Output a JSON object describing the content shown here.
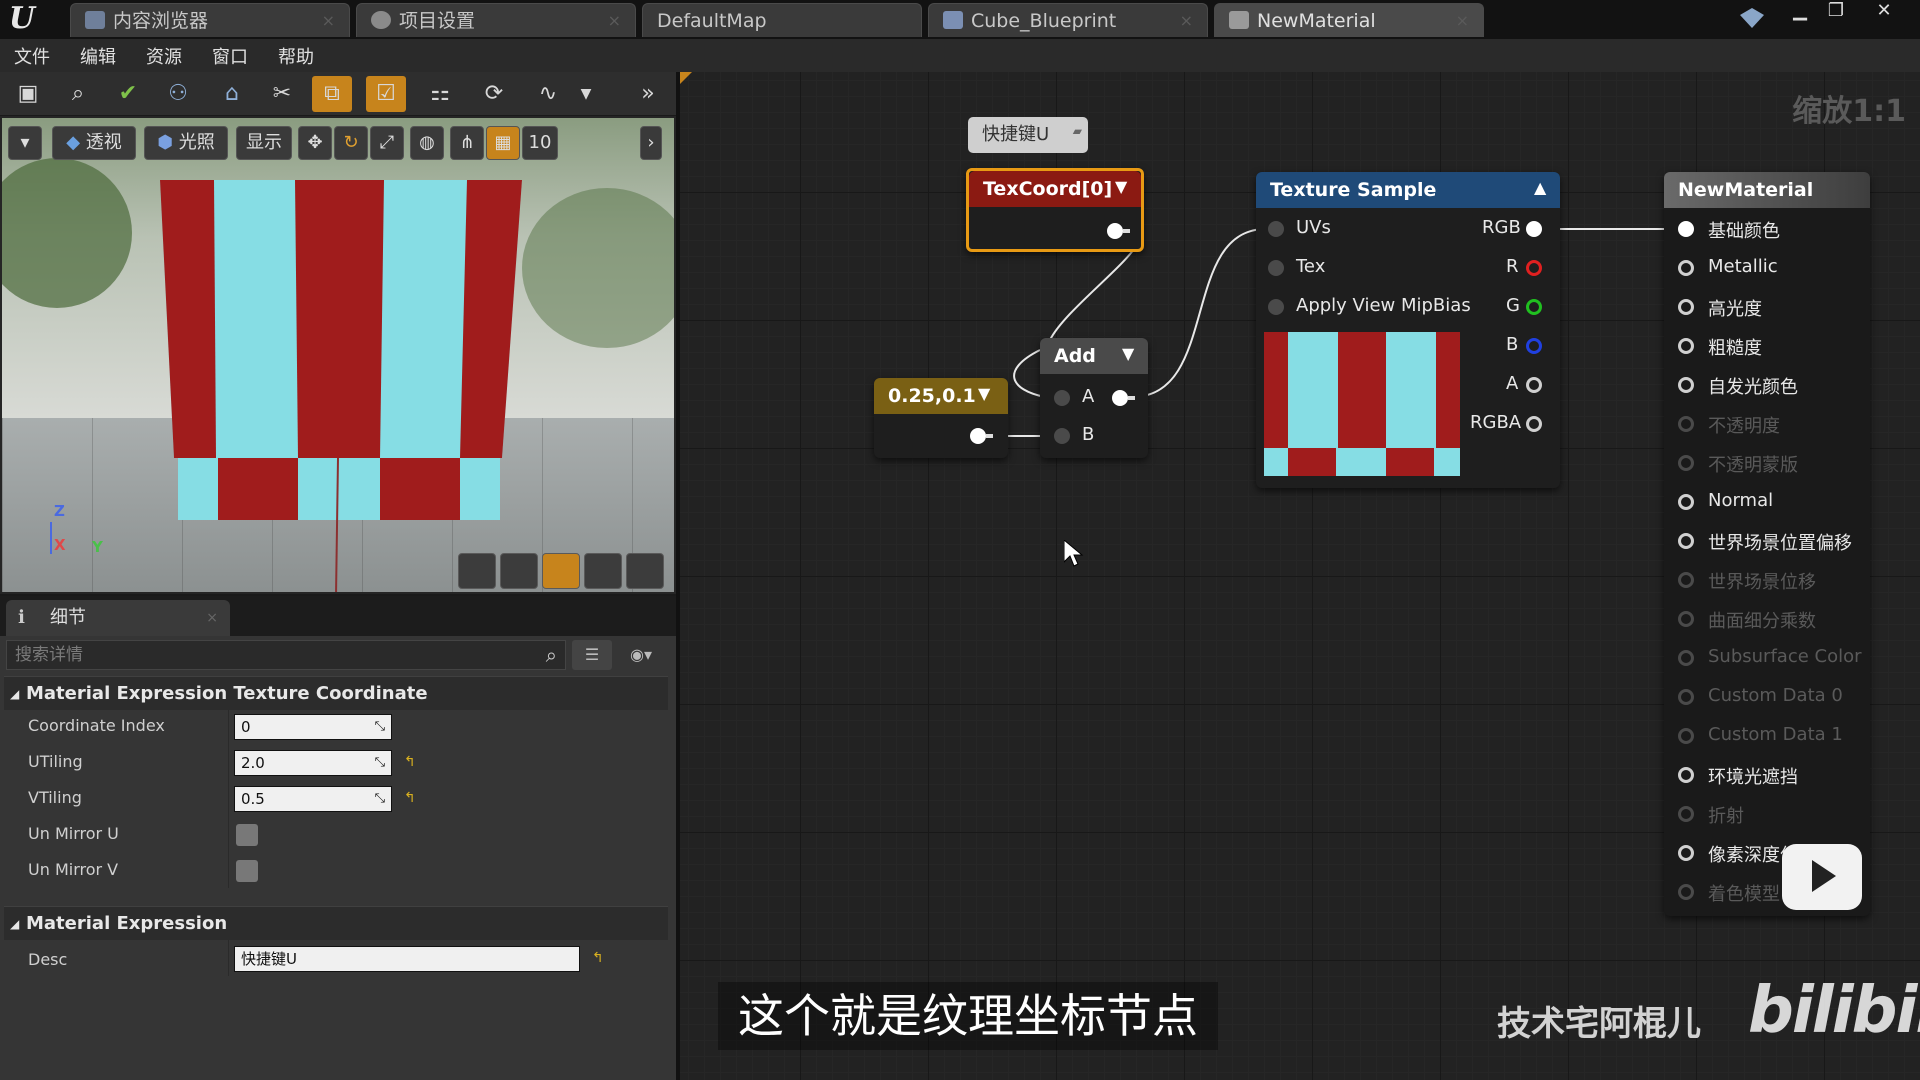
{
  "window": {
    "tabs": [
      {
        "label": "内容浏览器"
      },
      {
        "label": "项目设置"
      },
      {
        "label": "DefaultMap"
      },
      {
        "label": "Cube_Blueprint"
      },
      {
        "label": "NewMaterial"
      }
    ]
  },
  "menu": {
    "items": [
      "文件",
      "编辑",
      "资源",
      "窗口",
      "帮助"
    ]
  },
  "viewport": {
    "perspective_label": "透视",
    "lighting_label": "光照",
    "show_label": "显示",
    "grid_size": "10",
    "axis_z": "Z",
    "axis_x": "X",
    "axis_y": "Y"
  },
  "details": {
    "tab_label": "细节",
    "search_placeholder": "搜索详情",
    "section1": "Material Expression Texture Coordinate",
    "props": [
      {
        "label": "Coordinate Index",
        "value": "0"
      },
      {
        "label": "UTiling",
        "value": "2.0"
      },
      {
        "label": "VTiling",
        "value": "0.5"
      },
      {
        "label": "Un Mirror U"
      },
      {
        "label": "Un Mirror V"
      }
    ],
    "section2": "Material Expression",
    "desc_label": "Desc",
    "desc_value": "快捷键U"
  },
  "graph": {
    "zoom": "缩放1:1",
    "comment": "快捷键U",
    "texcoord_title": "TexCoord[0]",
    "constant_title": "0.25,0.1",
    "add_title": "Add",
    "add_pins": [
      "A",
      "B"
    ],
    "texture_title": "Texture Sample",
    "texture_inputs": [
      "UVs",
      "Tex",
      "Apply View MipBias"
    ],
    "texture_outputs": [
      "RGB",
      "R",
      "G",
      "B",
      "A",
      "RGBA"
    ],
    "material_title": "NewMaterial",
    "material_pins": [
      {
        "label": "基础颜色",
        "active": true
      },
      {
        "label": "Metallic",
        "active": true
      },
      {
        "label": "高光度",
        "active": true
      },
      {
        "label": "粗糙度",
        "active": true
      },
      {
        "label": "自发光颜色",
        "active": true
      },
      {
        "label": "不透明度",
        "active": false
      },
      {
        "label": "不透明蒙版",
        "active": false
      },
      {
        "label": "Normal",
        "active": true
      },
      {
        "label": "世界场景位置偏移",
        "active": true
      },
      {
        "label": "世界场景位移",
        "active": false
      },
      {
        "label": "曲面细分乘数",
        "active": false
      },
      {
        "label": "Subsurface Color",
        "active": false
      },
      {
        "label": "Custom Data 0",
        "active": false
      },
      {
        "label": "Custom Data 1",
        "active": false
      },
      {
        "label": "环境光遮挡",
        "active": true
      },
      {
        "label": "折射",
        "active": false
      },
      {
        "label": "像素深度偏移",
        "active": true
      },
      {
        "label": "着色模型",
        "active": false
      }
    ]
  },
  "overlay": {
    "subtitle": "这个就是纹理坐标节点",
    "watermark": "技术宅阿棍儿",
    "bilibili": "bilibili"
  },
  "colors": {
    "accent_orange": "#c7841c",
    "texcoord_head": "#8b1a12",
    "texture_head": "#1f4a78",
    "material_head": "#5a5a5a",
    "constant_head": "#7a6014",
    "add_head": "#4a4a4a",
    "red_stripe": "#a01c1c",
    "cyan_stripe": "#86dde4"
  }
}
